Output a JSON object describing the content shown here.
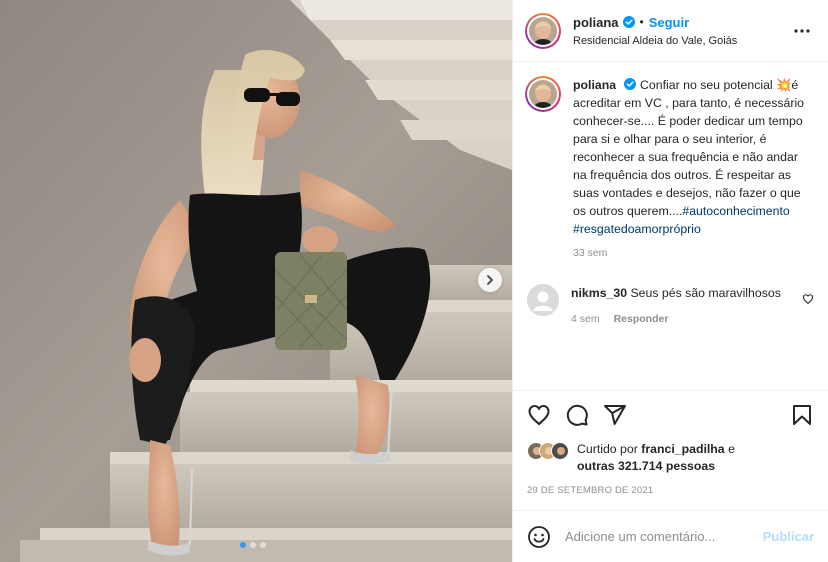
{
  "header": {
    "username": "poliana",
    "separator": "•",
    "follow_label": "Seguir",
    "location": "Residencial Aldeia do Vale, Goiás"
  },
  "caption": {
    "username": "poliana",
    "text_part1": "Confiar no seu potencial 💥é acreditar em VC , para tanto, é necessário conhecer-se.... É poder dedicar um tempo para si e olhar para o seu interior, é reconhecer a sua frequência e não andar na frequência dos outros. É respeitar as suas vontades e desejos, não fazer o que os outros querem....",
    "hashtag1": "#autoconhecimento",
    "hashtag2": "#resgatedoamorpróprio",
    "time": "33 sem"
  },
  "comment": {
    "username": "nikms_30",
    "text": "Seus pés são maravilhosos",
    "time": "4 sem",
    "reply_label": "Responder"
  },
  "likes": {
    "prefix": "Curtido por",
    "user": "franci_padilha",
    "connector": "e",
    "others": "outras 321.714 pessoas"
  },
  "date": "29 DE SETEMBRO DE 2021",
  "add_comment": {
    "placeholder": "Adicione um comentário...",
    "publish_label": "Publicar"
  },
  "icons": {
    "verified": "verified-badge-icon",
    "more": "more-options-icon",
    "like": "heart-icon",
    "comment": "comment-icon",
    "share": "share-icon",
    "save": "bookmark-icon",
    "emoji": "emoji-icon",
    "next": "chevron-right-icon"
  },
  "colors": {
    "link_blue": "#0095f6",
    "hashtag": "#00376b",
    "muted": "#8e8e8e",
    "publish_disabled": "#b2dffc"
  },
  "carousel": {
    "slide_count": 3,
    "active_index": 0
  }
}
